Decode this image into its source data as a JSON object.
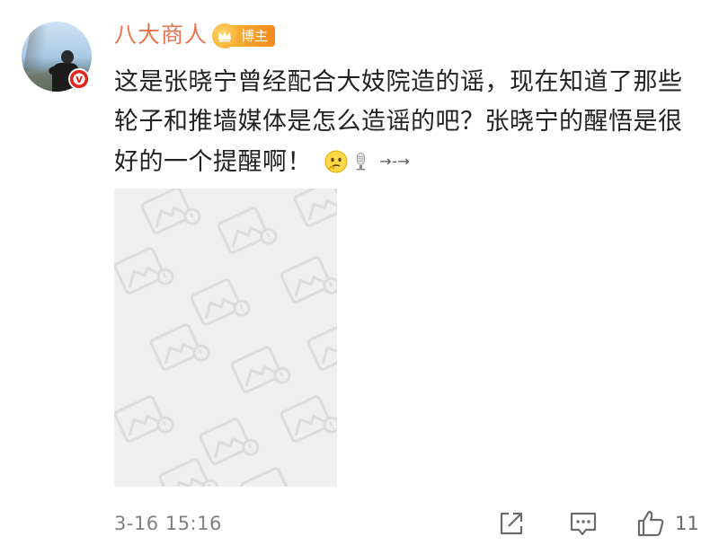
{
  "author": {
    "name": "八大商人",
    "badge_label": "博主",
    "avatar_icon": "user-avatar-photo",
    "verified_icon": "verified-v-icon",
    "name_color": "#eb7350"
  },
  "comment": {
    "text": "这是张晓宁曾经配合大妓院造的谣，现在知道了那些轮子和推墙媒体是怎么造谣的吧？张晓宁的醒悟是很好的一个提醒啊！",
    "emojis": [
      "thinking-face-emoji",
      "microphone-emoji"
    ],
    "tail": "→-→"
  },
  "media": {
    "icon": "image-placeholder-icon"
  },
  "footer": {
    "timestamp": "3-16 15:16",
    "share_icon": "share-icon",
    "comment_icon": "comment-icon",
    "like_icon": "thumbs-up-icon",
    "like_count": "11"
  }
}
